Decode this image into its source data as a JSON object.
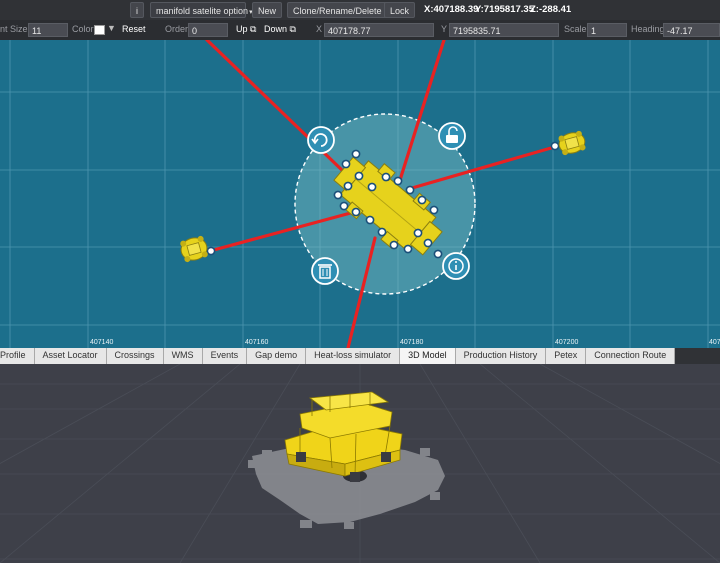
{
  "toolbar1": {
    "info_label": "i",
    "dropdown_value": "manifold satelite option",
    "new_label": "New",
    "clone_label": "Clone/Rename/Delete",
    "lock_label": "Lock",
    "x_readout": "X:407188.39",
    "y_readout": "Y:7195817.35",
    "z_readout": "Z:-288.41"
  },
  "toolbar2": {
    "font_size_label": "nt Size:",
    "font_size_value": "11",
    "color_label": "Color",
    "reset_label": "Reset",
    "order_label": "Order",
    "order_value": "0",
    "up_label": "Up",
    "down_label": "Down",
    "x_label": "X",
    "x_value": "407178.77",
    "y_label": "Y",
    "y_value": "7195835.71",
    "scale_label": "Scale",
    "scale_value": "1",
    "heading_label": "Heading",
    "heading_value": "-47.17"
  },
  "map": {
    "axis_labels": [
      "407140",
      "407160",
      "407180",
      "407200",
      "407"
    ],
    "background": "#1c6f8c",
    "pipeline_color": "#e82222",
    "asset_color": "#e6d21c",
    "controls": [
      "rotate-icon",
      "unlock-icon",
      "trash-icon",
      "info-icon"
    ]
  },
  "tabs": [
    {
      "label": "Profile",
      "active": false
    },
    {
      "label": "Asset Locator",
      "active": false
    },
    {
      "label": "Crossings",
      "active": false
    },
    {
      "label": "WMS",
      "active": false
    },
    {
      "label": "Events",
      "active": false
    },
    {
      "label": "Gap demo",
      "active": false
    },
    {
      "label": "Heat-loss simulator",
      "active": false
    },
    {
      "label": "3D Model",
      "active": true
    },
    {
      "label": "Production History",
      "active": false
    },
    {
      "label": "Petex",
      "active": false
    },
    {
      "label": "Connection Route",
      "active": false
    }
  ]
}
